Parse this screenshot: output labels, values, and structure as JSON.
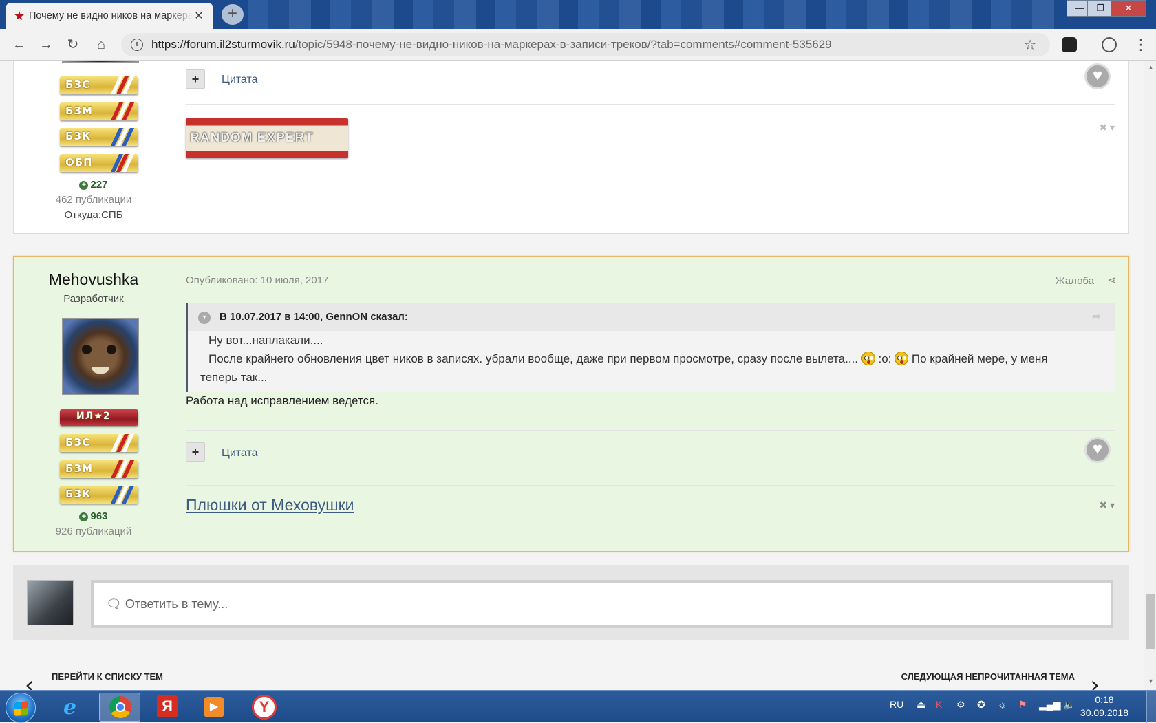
{
  "browser": {
    "tab_title": "Почему не видно ников на маркерах в записи треков",
    "tab_close": "✕",
    "new_tab": "+",
    "url_host": "https://forum.il2sturmovik.ru",
    "url_path": "/topic/5948-почему-не-видно-ников-на-маркерах-в-записи-треков/?tab=comments#comment-535629",
    "window_min": "—",
    "window_max": "❐",
    "window_close": "✕"
  },
  "post1": {
    "ribbons": [
      "БЗС",
      "БЗМ",
      "БЗК",
      "ОБП"
    ],
    "reputation": "227",
    "posts_count": "462 публикации",
    "location": "Откуда:СПБ",
    "quote_label": "Цитата",
    "signature_text": "RANDOM EXPERT"
  },
  "post2": {
    "author": "Mehovushka",
    "role": "Разработчик",
    "ribbons": [
      "ИЛ★2",
      "БЗС",
      "БЗМ",
      "БЗК"
    ],
    "reputation": "963",
    "posts_count": "926 публикаций",
    "published": "Опубликовано: 10 июля, 2017",
    "report": "Жалоба",
    "quote_header": "В 10.07.2017 в 14:00, GennON сказал:",
    "quote_line1": "Ну вот...наплакали....",
    "quote_line2_a": "После крайнего обновления цвет ников в записях. убрали вообще, даже при первом просмотре, сразу после вылета....",
    "quote_line2_b": ":o:",
    "quote_line2_c": "По крайней мере, у меня",
    "quote_line3": "теперь так...",
    "body": "Работа над исправлением ведется.",
    "quote_label": "Цитата",
    "signature_link": "Плюшки от Меховушки"
  },
  "reply": {
    "placeholder": "Ответить в тему..."
  },
  "pagenav": {
    "back": "ПЕРЕЙТИ К СПИСКУ ТЕМ",
    "next": "СЛЕДУЮЩАЯ НЕПРОЧИТАННАЯ ТЕМА"
  },
  "taskbar": {
    "lang": "RU",
    "time": "0:18",
    "date": "30.09.2018"
  },
  "colors": {
    "highlight_bg": "#e9f6e2",
    "highlight_border": "#e3b866",
    "link": "#3d5a80"
  }
}
